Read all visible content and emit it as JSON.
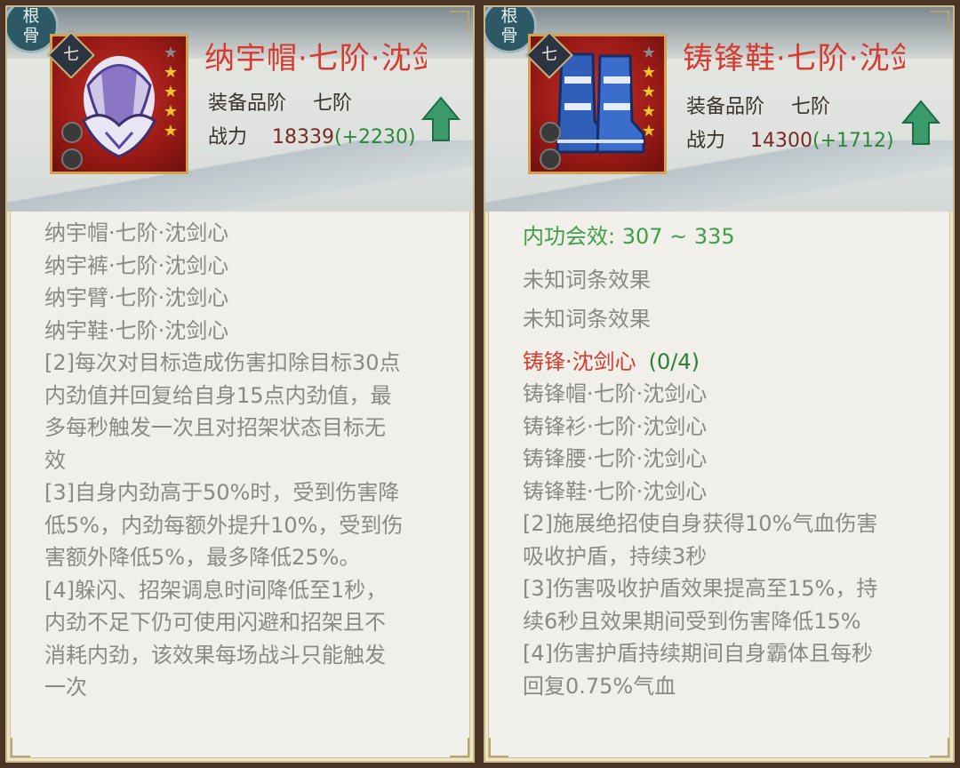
{
  "left": {
    "seal": "根骨",
    "tier": "七",
    "stars_lit": 4,
    "stars_total": 5,
    "title": "纳宇帽·七阶·沈剑心",
    "grade_label": "装备品阶",
    "grade_value": "七阶",
    "power_label": "战力",
    "power_value": "18339",
    "power_bonus": "(+2230)",
    "set_items": [
      "纳宇帽·七阶·沈剑心",
      "纳宇裤·七阶·沈剑心",
      "纳宇臂·七阶·沈剑心",
      "纳宇鞋·七阶·沈剑心"
    ],
    "effect_lines": [
      "[2]每次对目标造成伤害扣除目标30点",
      "内劲值并回复给自身15点内劲值，最",
      "多每秒触发一次且对招架状态目标无",
      "效",
      "[3]自身内劲高于50%时，受到伤害降",
      "低5%，内劲每额外提升10%，受到伤",
      "害额外降低5%，最多降低25%。",
      "[4]躲闪、招架调息时间降低至1秒，",
      "内劲不足下仍可使用闪避和招架且不",
      "消耗内劲，该效果每场战斗只能触发",
      "一次"
    ]
  },
  "right": {
    "seal": "根骨",
    "tier": "七",
    "stars_lit": 4,
    "stars_total": 5,
    "title": "铸锋鞋·七阶·沈剑心",
    "grade_label": "装备品阶",
    "grade_value": "七阶",
    "power_label": "战力",
    "power_value": "14300",
    "power_bonus": "(+1712)",
    "attribute": "内功会效: 307 ~ 335",
    "unknown_1": "未知词条效果",
    "unknown_2": "未知词条效果",
    "set_name": "铸锋·沈剑心",
    "set_count": "(0/4)",
    "set_items": [
      "铸锋帽·七阶·沈剑心",
      "铸锋衫·七阶·沈剑心",
      "铸锋腰·七阶·沈剑心",
      "铸锋鞋·七阶·沈剑心"
    ],
    "effect_lines": [
      "[2]施展绝招使自身获得10%气血伤害",
      "吸收护盾，持续3秒",
      "[3]伤害吸收护盾效果提高至15%，持",
      "续6秒且效果期间受到伤害降低15%",
      "[4]伤害护盾持续期间自身霸体且每秒",
      "回复0.75%气血"
    ]
  },
  "colors": {
    "title_red": "#d63b30",
    "bonus_green": "#2a8a3a",
    "attr_green": "#3f9e46",
    "body_gray": "#8a8984",
    "frame_gold": "#d3a24a"
  }
}
